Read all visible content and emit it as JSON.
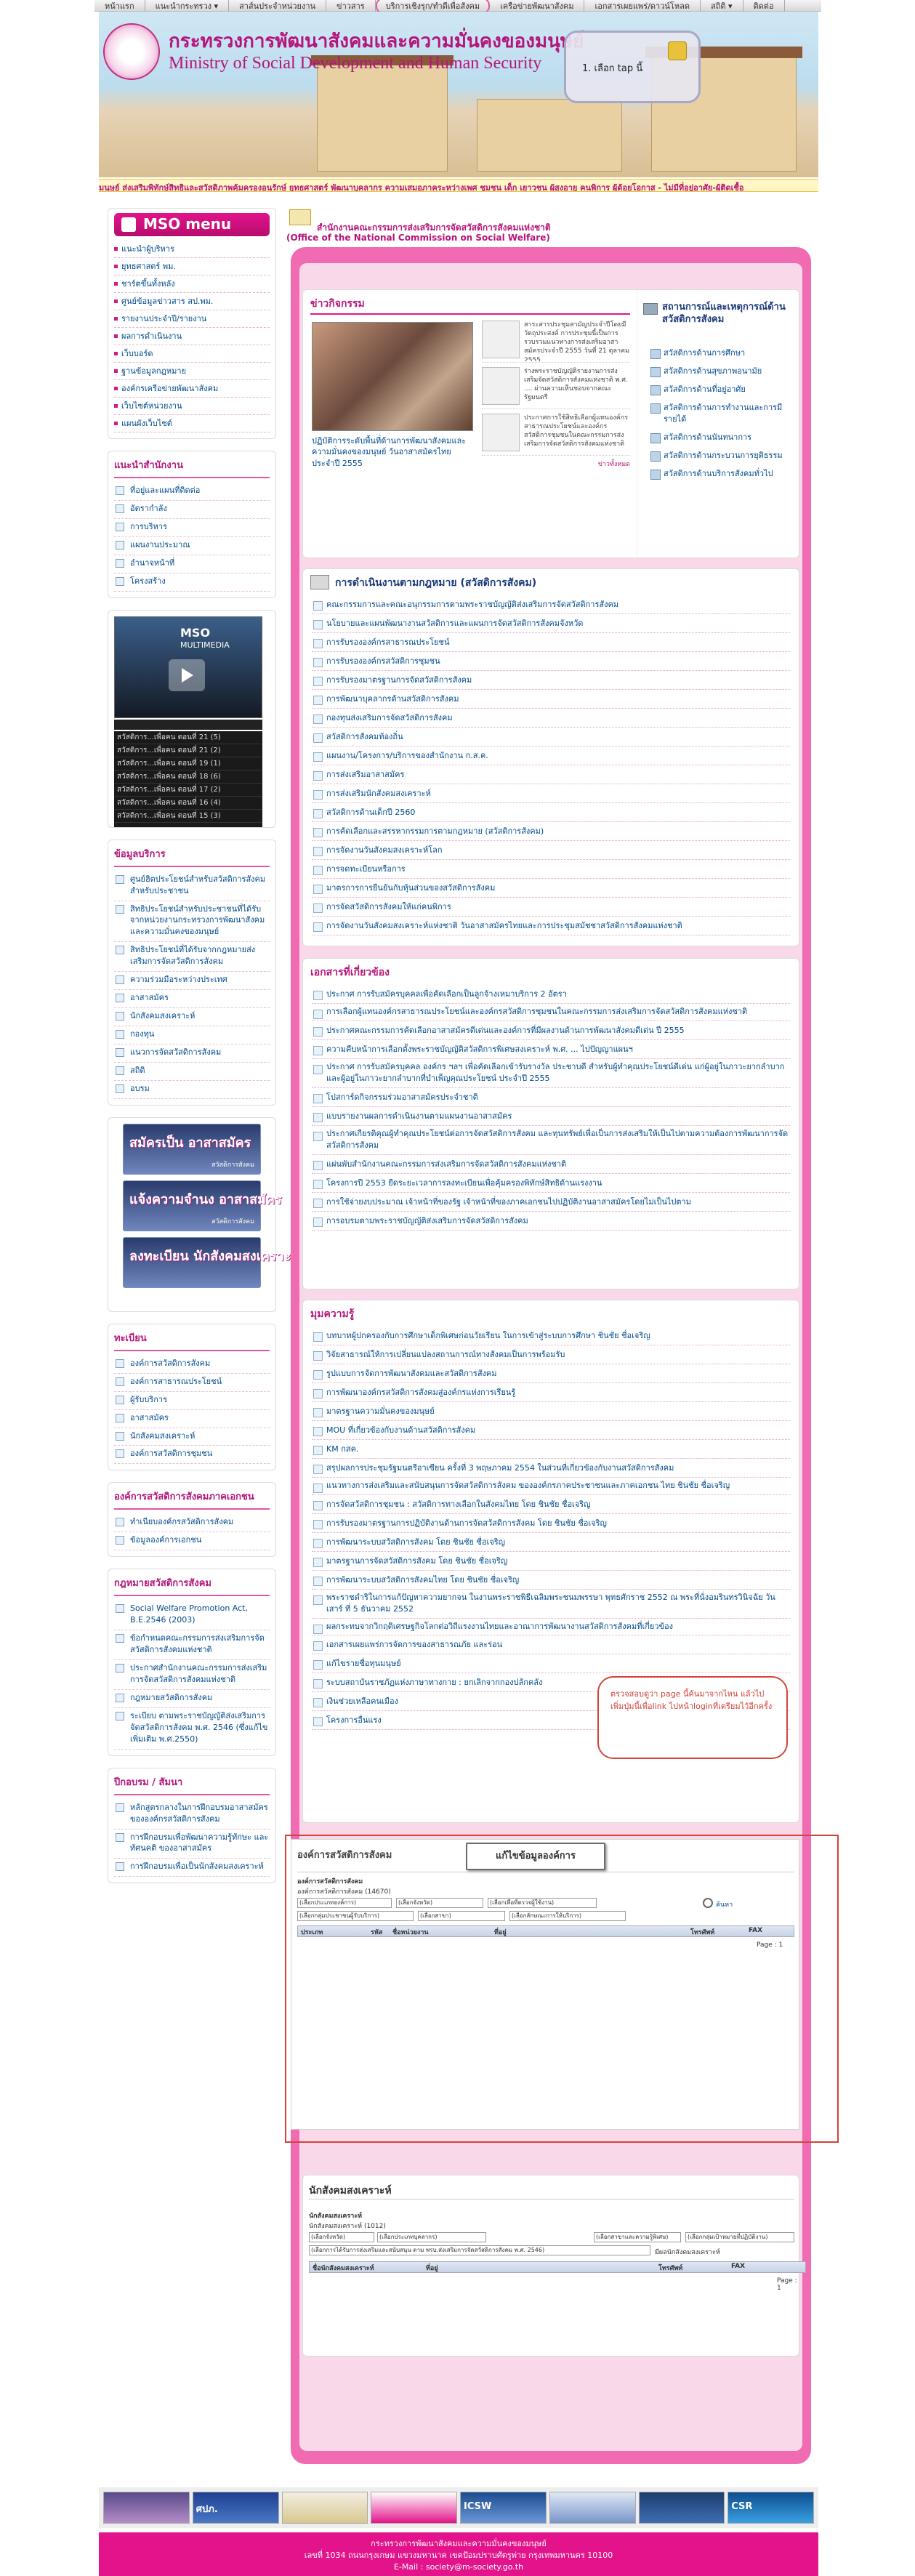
{
  "topnav": [
    "หน้าแรก",
    "แนะนำกระทรวง ▾",
    "สาส์นประจำหน่วยงาน",
    "ข่าวสาร",
    "บริการเชิงรุก/ทำดีเพื่อสังคม",
    "เครือข่ายพัฒนาสังคม",
    "เอกสารเผยแพร่/ดาวน์โหลด",
    "สถิติ ▾",
    "ติดต่อ"
  ],
  "header": {
    "title_th": "กระทรวงการพัฒนาสังคมและความมั่นคงของมนุษย์",
    "title_en": "Ministry of Social Development and Human Security",
    "login_text": "1. เลือก tap นี้"
  },
  "marquee": "มนุษย์ ส่งเสริมพิทักษ์สิทธิและสวัสดิภาพคุ้มครองอนุรักษ์ ยุทธศาสตร์ พัฒนาบุคลากร ความเสมอภาคระหว่างเพศ ชุมชน เด็ก เยาวชน ผู้สูงอายุ คนพิการ ผู้ด้อยโอกาส - ไม่มีที่อยู่อาศัย-ผู้ติดเชื้อ",
  "left": {
    "menu_title": "MSO menu",
    "menu_items": [
      "แนะนำผู้บริหาร",
      "ยุทธศาสตร์ พม.",
      "ชาร์ตขึ้นทั้งหลัง",
      "ศูนย์ข้อมูลข่าวสาร สป.พม.",
      "รายงานประจำปี/รายงาน",
      "ผลการดำเนินงาน",
      "เว็บบอร์ด",
      "ฐานข้อมูลกฎหมาย",
      "องค์กรเครือข่ายพัฒนาสังคม",
      "เว็บไซต์หน่วยงาน",
      "แผนผังเว็บไซต์"
    ],
    "agency_title": "แนะนำสำนักงาน",
    "agency_items": [
      "ที่อยู่และแผนที่ติดต่อ",
      "อัตรากำลัง",
      "การบริหาร",
      "แผนงานประมาณ",
      "อำนาจหน้าที่",
      "โครงสร้าง"
    ],
    "mm_title": "MSO",
    "mm_sub": "MULTIMEDIA",
    "mm_list": [
      "สวัสดิการ...เพื่อคน ตอนที่ 21 (5)",
      "สวัสดิการ...เพื่อคน ตอนที่ 21 (2)",
      "สวัสดิการ...เพื่อคน ตอนที่ 19 (1)",
      "สวัสดิการ...เพื่อคน ตอนที่ 18 (6)",
      "สวัสดิการ...เพื่อคน ตอนที่ 17 (2)",
      "สวัสดิการ...เพื่อคน ตอนที่ 16 (4)",
      "สวัสดิการ...เพื่อคน ตอนที่ 15 (3)"
    ],
    "service_title": "ข้อมูลบริการ",
    "service_items": [
      "ศูนย์ฮิตประโยชน์สำหรับสวัสดิการสังคมสำหรับประชาชน",
      "สิทธิประโยชน์สำหรับประชาชนที่ได้รับจากหน่วยงานกระทรวงการพัฒนาสังคมและความมั่นคงของมนุษย์",
      "สิทธิประโยชน์ที่ได้รับจากกฎหมายส่งเสริมการจัดสวัสดิการสังคม",
      "ความร่วมมือระหว่างประเทศ",
      "อาสาสมัคร",
      "นักสังคมสงเคราะห์",
      "กองทุน",
      "แนวการจัดสวัสดิการสังคม",
      "สถิติ",
      "อบรม"
    ],
    "banners": [
      [
        "สมัครเป็น อาสาสมัคร",
        "สวัสดิการสังคม"
      ],
      [
        "แจ้งความจำนง อาสาสมัคร",
        "สวัสดิการสังคม"
      ],
      [
        "ลงทะเบียน นักสังคมสงเคราะห์",
        ""
      ]
    ],
    "register_title": "ทะเบียน",
    "register_items": [
      "องค์การสวัสดิการสังคม",
      "องค์การสาธารณประโยชน์",
      "ผู้รับบริการ",
      "อาสาสมัคร",
      "นักสังคมสงเคราะห์",
      "องค์การสวัสดิการชุมชน"
    ],
    "privorg_title": "องค์การสวัสดิการสังคมภาคเอกชน",
    "privorg_items": [
      "ทำเนียบองค์กรสวัสดิการสังคม",
      "ข้อมูลองค์การเอกชน"
    ],
    "law_title": "กฎหมายสวัสดิการสังคม",
    "law_items": [
      "Social Welfare Promotion Act, B.E.2546 (2003)",
      "ข้อกำหนดคณะกรรมการส่งเสริมการจัดสวัสดิการสังคมแห่งชาติ",
      "ประกาศสำนักงานคณะกรรมการส่งเสริมการจัดสวัสดิการสังคมแห่งชาติ",
      "กฎหมายสวัสดิการสังคม",
      "ระเบียบ ตามพระราชบัญญัติส่งเสริมการจัดสวัสดิการสังคม พ.ศ. 2546 (ซึ่งแก้ไขเพิ่มเติม พ.ศ.2550)"
    ],
    "calendar_title": "ปีกอบรม / สัมนา",
    "calendar_items": [
      "หลักสูตรกลางในการฝึกอบรมอาสาสมัครขององค์กรสวัสดิการสังคม",
      "การฝึกอบรมเพื่อพัฒนาความรู้ทักษะ และทัศนคติ ของอาสาสมัคร",
      "การฝึกอบรมเพื่อเป็นนักสังคมสงเคราะห์"
    ]
  },
  "main": {
    "head_th": "สำนักงานคณะกรรมการส่งเสริมการจัดสวัสดิการสังคมแห่งชาติ",
    "head_en": "(Office of the National Commission on Social Welfare)",
    "news_title": "ข่าวกิจกรรม",
    "news_caption": "ปฏิบัติการระดับพื้นที่ด้านการพัฒนาสังคมและความมั่นคงของมนุษย์ วันอาสาสมัครไทย ประจำปี 2555",
    "news_side": [
      "สาระสารประชุมสามัญประจำปีโดยมีวัตถุประสงค์ การประชุมนี้เป็นการรวบรวมแนวทางการส่งเสริมอาสาสมัครประจำปี 2555 วันที่ 21 ตุลาคม 2555",
      "ร่างพระราชบัญญัติรายงานการส่งเสริมจัดสวัสดิการสังคมแห่งชาติ พ.ศ. ....  ผ่านความเห็นชอบจากคณะรัฐมนตรี",
      "ประกาศการใช้สิทธิเลือกผู้แทนองค์กรสาธารณประโยชน์และองค์กรสวัสดิการชุมชนในคณะกรรมการส่งเสริมการจัดสวัสดิการสังคมแห่งชาติ"
    ],
    "news_more": "ข่าวทั้งหมด",
    "status_title": "สถานการณ์และเหตุการณ์ด้านสวัสดิการสังคม",
    "status_items": [
      "สวัสดิการด้านการศึกษา",
      "สวัสดิการด้านสุขภาพอนามัย",
      "สวัสดิการด้านที่อยู่อาศัย",
      "สวัสดิการด้านการทำงานและการมีรายได้",
      "สวัสดิการด้านนันทนาการ",
      "สวัสดิการด้านกระบวนการยุติธรรม",
      "สวัสดิการด้านบริการสังคมทั่วไป"
    ],
    "law_section_title": "การดำเนินงานตามกฎหมาย (สวัสดิการสังคม)",
    "law_links": [
      "คณะกรรมการและคณะอนุกรรมการตามพระราชบัญญัติส่งเสริมการจัดสวัสดิการสังคม",
      "นโยบายและแผนพัฒนางานสวัสดิการและแผนการจัดสวัสดิการสังคมจังหวัด",
      "การรับรององค์กรสาธารณประโยชน์",
      "การรับรององค์กรสวัสดิการชุมชน",
      "การรับรองมาตรฐานการจัดสวัสดิการสังคม",
      "การพัฒนาบุคลากรด้านสวัสดิการสังคม",
      "กองทุนส่งเสริมการจัดสวัสดิการสังคม",
      "สวัสดิการสังคมท้องถิ่น",
      "แผนงาน/โครงการ/บริการของสำนักงาน ก.ส.ค.",
      "การส่งเสริมอาสาสมัคร",
      "การส่งเสริมนักสังคมสงเคราะห์",
      "สวัสดิการด้านเด็กปี 2560",
      "การคัดเลือกและสรรหากรรมการตามกฎหมาย (สวัสดิการสังคม)",
      "การจัดงานวันสังคมสงเคราะห์โลก",
      "การจดทะเบียนหรือการ",
      "มาตรการการยืนยันกับหุ้นส่วนของสวัสดิการสังคม",
      "การจัดสวัสดิการสังคมให้แก่คนพิการ",
      "การจัดงานวันสังคมสงเคราะห์แห่งชาติ วันอาสาสมัครไทยและการประชุมสมัชชาสวัสดิการสังคมแห่งชาติ"
    ],
    "doc_title": "เอกสารที่เกี่ยวข้อง",
    "doc_links": [
      "ประกาศ การรับสมัครบุคคลเพื่อคัดเลือกเป็นลูกจ้างเหมาบริการ 2 อัตรา",
      "การเลือกผู้แทนองค์กรสาธารณประโยชน์และองค์กรสวัสดิการชุมชนในคณะกรรมการส่งเสริมการจัดสวัสดิการสังคมแห่งชาติ",
      "ประกาศคณะกรรมการคัดเลือกอาสาสมัครดีเด่นและองค์การที่มีผลงานด้านการพัฒนาสังคมดีเด่น ปี 2555",
      "ความคืบหน้าการเลือกตั้งพระราชบัญญัติสวัสดิการพิเศษสงเคราะห์ พ.ศ. ... ไปปัญญาแผนฯ",
      "ประกาศ การรับสมัครบุคคล องค์กร ฯลฯ เพื่อคัดเลือกเข้ารับรางวัล ประชาบดี สำหรับผู้ทำคุณประโยชน์ดีเด่น แก่ผู้อยู่ในภาวะยากลำบาก และผู้อยู่ในภาวะยากลำบากที่บำเพ็ญคุณประโยชน์ ประจำปี 2555",
      "โปสการ์ดกิจกรรมร่วมอาสาสมัครประจำชาติ",
      "แบบรายงานผลการดำเนินงานตามแผนงานอาสาสมัคร",
      "ประกาศเกียรติคุณผู้ทำคุณประโยชน์ต่อการจัดสวัสดิการสังคม และทุนทรัพย์เพื่อเป็นการส่งเสริมให้เป็นไปตามความต้องการพัฒนาการจัดสวัสดิการสังคม",
      "แผ่นพับสำนักงานคณะกรรมการส่งเสริมการจัดสวัสดิการสังคมแห่งชาติ",
      "โครงการปี 2553 ยืดระยะเวลาการลงทะเบียนเพื่อคุ้มครองพิทักษ์สิทธิด้านแรงงาน",
      "การใช้จ่ายงบประมาณ เจ้าหน้าที่ของรัฐ เจ้าหน้าที่ของภาคเอกชนไปปฏิบัติงานอาสาสมัครโดยไม่เป็นไปตาม",
      "การอบรมตามพระราชบัญญัติส่งเสริมการจัดสวัสดิการสังคม"
    ],
    "know_title": "มุมความรู้",
    "know_links": [
      "บทบาทผู้ปกครองกับการศึกษาเด็กพิเศษก่อนวัยเรียน ในการเข้าสู่ระบบการศึกษา ชินชัย ชื่อเจริญ",
      "วิจัยสาธารณ์ให้การเปลี่ยนแปลงสถานการณ์ทางสังคมเป็นการพร้อมรับ",
      "รูปแบบการจัดการพัฒนาสังคมและสวัสดิการสังคม",
      "การพัฒนาองค์กรสวัสดิการสังคมสู่องค์กรแห่งการเรียนรู้",
      "มาตรฐานความมั่นคงของมนุษย์",
      "MOU ที่เกี่ยวข้องกับงานด้านสวัสดิการสังคม",
      "KM กสค.",
      "สรุปผลการประชุมรัฐมนตรีอาเซียน ครั้งที่ 3 พฤษภาคม 2554 ในส่วนที่เกี่ยวข้องกับงานสวัสดิการสังคม",
      "แนวทางการส่งเสริมและสนับสนุนการจัดสวัสดิการสังคม ขององค์กรภาคประชาชนและภาคเอกชน ไทย ชินชัย ชื่อเจริญ",
      "การจัดสวัสดิการชุมชน : สวัสดิการทางเลือกในสังคมไทย โดย ชินชัย ชื่อเจริญ",
      "การรับรองมาตรฐานการปฏิบัติงานด้านการจัดสวัสดิการสังคม โดย ชินชัย ชื่อเจริญ",
      "การพัฒนาระบบสวัสดิการสังคม โดย ชินชัย ชื่อเจริญ",
      "มาตรฐานการจัดสวัสดิการสังคม โดย ชินชัย ชื่อเจริญ",
      "การพัฒนาระบบสวัสดิการสังคมไทย โดย ชินชัย ชื่อเจริญ",
      "พระราชดำริในการแก้ปัญหาความยากจน ในงานพระราชพิธีเฉลิมพระชนมพรรษา พุทธศักราช 2552 ณ พระที่นั่งอมรินทรวินิจฉัย วันเสาร์ ที่ 5 ธันวาคม 2552",
      "ผลกระทบจากวิกฤติเศรษฐกิจโลกต่อวิถีแรงงานไทยและอาณาการพัฒนางานสวัสดิการสังคมที่เกี่ยวข้อง",
      "เอกสารเผยแพร่การจัดการของสาธารณภัย และร่อน",
      "แก้ไขรายชื่อทุนมนุษย์",
      "ระบบสถาบันราชภัฏแห่งภาษาทางกาย : ยกเลิกจากกองปลักคลัง",
      "เงินช่วยเหลือคนเมือง",
      "โครงการอื่นแรง"
    ]
  },
  "popup_text": "ตรวจสอบดูว่า page นี้ค้นมาจากไหน แล้วไปเพิ่มปุ่มนี้เพื่อlink ไปหน้าloginที่เตรียมไว้อีกครั้ง",
  "org": {
    "title": "องค์การสวัสดิการสังคม",
    "button": "แก้ไขข้อมูลองค์การ",
    "sub1": "องค์การสวัสดิการสังคม",
    "sub2": "องค์การสวัสดิการสังคม (14670)",
    "sel1": "(เลือกประเภทองค์การ)",
    "sel2": "(เลือกจังหวัด)",
    "sel3": "(เลือกเพื่อที่ตรวจผู้ใช้งาน)",
    "sel4": "(เลือกกลุ่มประชาชนผู้รับบริการ)",
    "sel5": "(เลือกสาขา)",
    "sel6": "(เลือกลักษณะการให้บริการ)",
    "search": "ค้นหา",
    "cols": [
      "ประเภท",
      "รหัส",
      "ชื่อหน่วยงาน",
      "ที่อยู่",
      "โทรศัพท์",
      "FAX"
    ],
    "page": "Page : 1"
  },
  "sw": {
    "title": "นักสังคมสงเคราะห์",
    "sub1": "นักสังคมสงเคราะห์",
    "sub2": "นักสังคมสงเคราะห์ (1012)",
    "sel1": "(เลือกจังหวัด)",
    "sel2": "(เลือกประเภทบุคลากร)",
    "sel3": "(เลือกสาขาและความรู้พิเศษ)",
    "sel4": "(เลือกกลุ่มเป้าหมายที่ปฏิบัติงาน)",
    "sel5": "(เลือกการได้รับการส่งเสริมและสนับสนุน ตาม พรบ.ส่งเสริมการจัดสวัสดิการสังคม พ.ศ. 2546)",
    "sel6": "มีผลนักสังคมสงเคราะห์",
    "cols": [
      "ชื่อนักสังคมสงเคราะห์",
      "ที่อยู่",
      "โทรศัพท์",
      "FAX"
    ],
    "page": "Page : 1"
  },
  "footer_banners": [
    "ศปภ.",
    "ICSW",
    "CSR"
  ],
  "footer": {
    "line1": "กระทรวงการพัฒนาสังคมและความมั่นคงของมนุษย์",
    "line2": "เลขที่ 1034 ถนนกรุงเกษม แขวงมหานาค เขตป้อมปราบศัตรูพ่าย กรุงเทพมหานคร 10100",
    "line3": "E-Mail : society@m-society.go.th"
  },
  "colors": {
    "accent": "#e3148b",
    "link": "#004a8c",
    "frame": "#f16bb2"
  }
}
